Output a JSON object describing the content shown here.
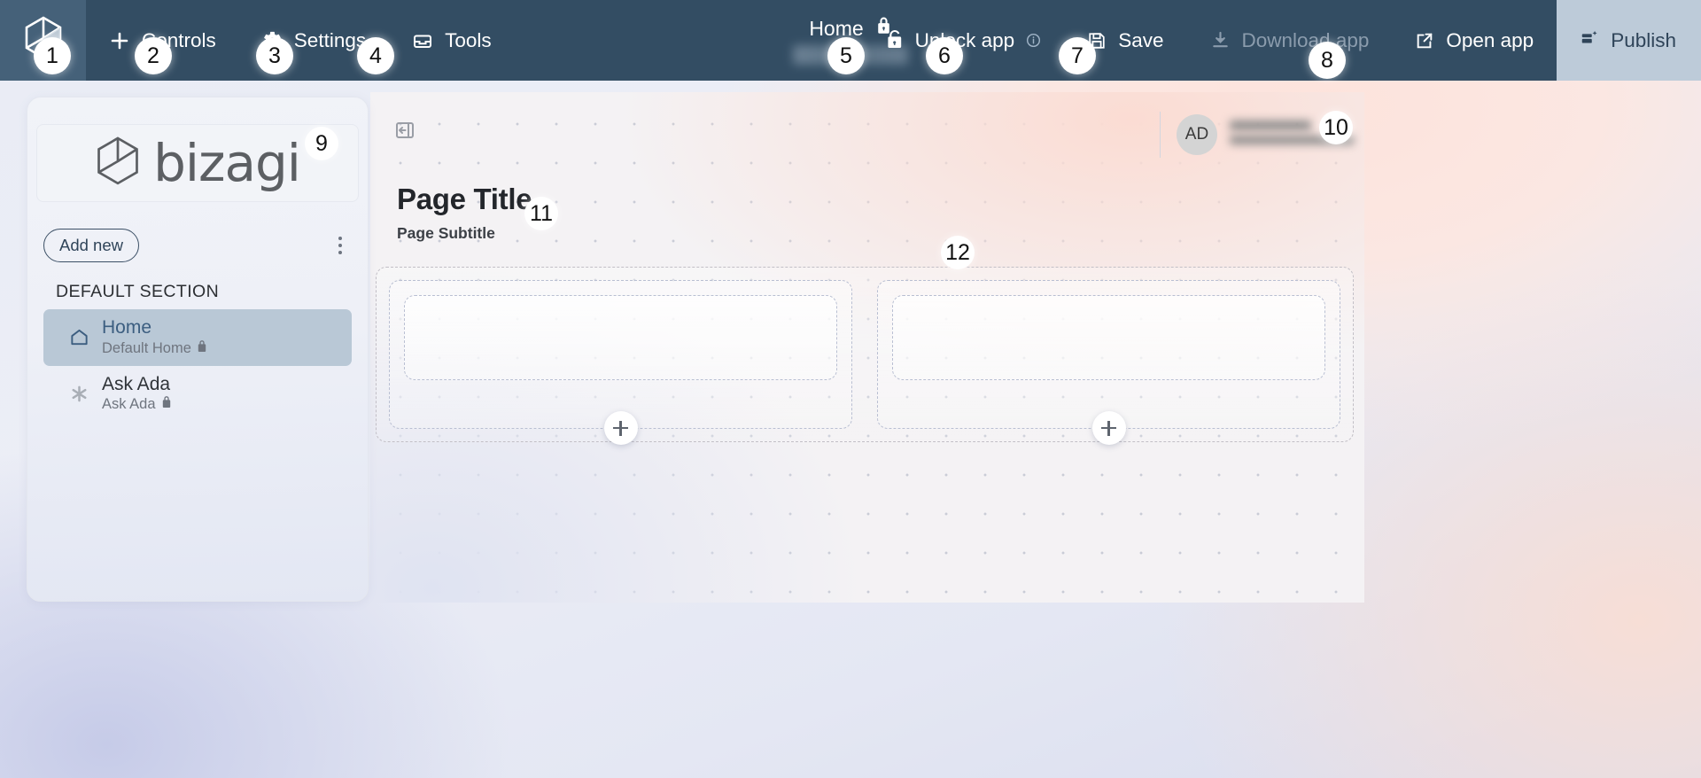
{
  "toolbar": {
    "logo_icon": "bizagi-cube-icon",
    "items": [
      {
        "label": "Controls",
        "icon": "plus-icon",
        "enabled": true
      },
      {
        "label": "Settings",
        "icon": "gear-icon",
        "enabled": true
      },
      {
        "label": "Tools",
        "icon": "toolbox-icon",
        "enabled": true
      }
    ],
    "center": {
      "title": "Home",
      "lock_icon": "lock-closed-icon",
      "subtitle_blurred": true
    },
    "right": [
      {
        "label": "Unlock app",
        "icon": "lock-open-icon",
        "info_icon": "info-circle-icon",
        "enabled": true
      },
      {
        "label": "Save",
        "icon": "floppy-disk-icon",
        "enabled": true
      },
      {
        "label": "Download app",
        "icon": "download-icon",
        "enabled": false
      },
      {
        "label": "Open app",
        "icon": "external-link-icon",
        "enabled": true
      }
    ],
    "publish": {
      "label": "Publish",
      "icon": "publish-icon"
    },
    "colors": {
      "bar": "#334d63",
      "logo_tile": "#456179",
      "publish_tile": "#bdcbd9",
      "text": "#ffffff",
      "text_disabled": "#8b9cad"
    }
  },
  "sidebar": {
    "brand": {
      "word": "bizagi",
      "icon": "bizagi-cube-icon"
    },
    "add_new_label": "Add new",
    "kebab_icon": "more-vertical-icon",
    "section_label": "DEFAULT SECTION",
    "items": [
      {
        "label": "Home",
        "sub": "Default Home",
        "icon": "home-icon",
        "lock_icon": "lock-closed-icon",
        "active": true
      },
      {
        "label": "Ask Ada",
        "sub": "Ask Ada",
        "icon": "asterisk-icon",
        "lock_icon": "lock-closed-icon",
        "active": false
      }
    ]
  },
  "canvas": {
    "collapse_icon": "collapse-sidebar-icon",
    "user": {
      "avatar_initials": "AD",
      "name_blurred": true
    },
    "page_title": "Page Title",
    "page_subtitle": "Page Subtitle",
    "dropzones": [
      {
        "add_label": "+",
        "add_icon": "plus-icon"
      },
      {
        "add_label": "+",
        "add_icon": "plus-icon"
      }
    ]
  },
  "callouts": [
    {
      "n": "1"
    },
    {
      "n": "2"
    },
    {
      "n": "3"
    },
    {
      "n": "4"
    },
    {
      "n": "5"
    },
    {
      "n": "6"
    },
    {
      "n": "7"
    },
    {
      "n": "8"
    },
    {
      "n": "9"
    },
    {
      "n": "10"
    },
    {
      "n": "11"
    },
    {
      "n": "12"
    }
  ]
}
